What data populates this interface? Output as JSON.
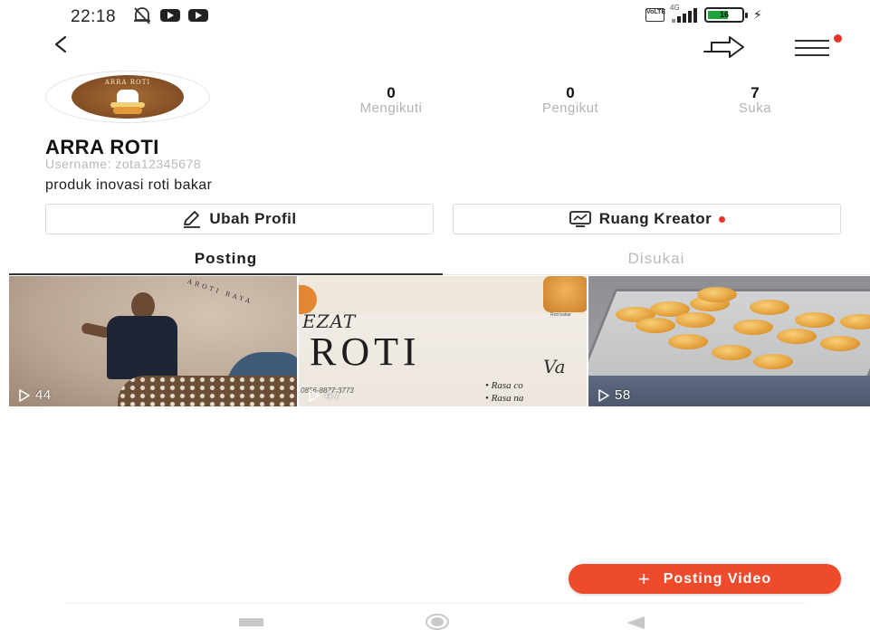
{
  "status_bar": {
    "time": "22:18",
    "battery_level": "16",
    "network_badge": "4G",
    "icons": [
      "mute-notification-icon",
      "youtube-icon",
      "youtube-icon",
      "volte-icon",
      "signal-icon",
      "battery-icon",
      "charging-icon"
    ]
  },
  "top_nav": {
    "icons": [
      "back-icon",
      "share-icon",
      "menu-icon"
    ]
  },
  "profile": {
    "name": "ARRA ROTI",
    "username": "Username: zota12345678",
    "bio": "produk inovasi roti bakar",
    "avatar_text": "ARRA ROTI",
    "stats": [
      {
        "value": "0",
        "label": "Mengikuti"
      },
      {
        "value": "0",
        "label": "Pengikut"
      },
      {
        "value": "7",
        "label": "Suka"
      }
    ]
  },
  "actions": {
    "edit_profile": "Ubah Profil",
    "creator_space": "Ruang Kreator"
  },
  "tabs": {
    "posting": "Posting",
    "liked": "Disukai",
    "active": "Posting"
  },
  "videos": [
    {
      "views": "44",
      "sign_text": "AROTI RAYA"
    },
    {
      "views": "47",
      "title_small": "EZAT",
      "title_big": "ROTI",
      "side_text": "Va",
      "phone": "0856-8877-3773",
      "bullets": [
        "• Rasa co",
        "• Rasa na"
      ],
      "tag": "Roti bakar"
    },
    {
      "views": "58"
    }
  ],
  "fab": {
    "label": "Posting Video"
  },
  "colors": {
    "accent": "#ee4a2c",
    "notification_dot": "#e8332a",
    "muted_text": "#b3b3b3",
    "battery_green": "#1fa43a"
  }
}
